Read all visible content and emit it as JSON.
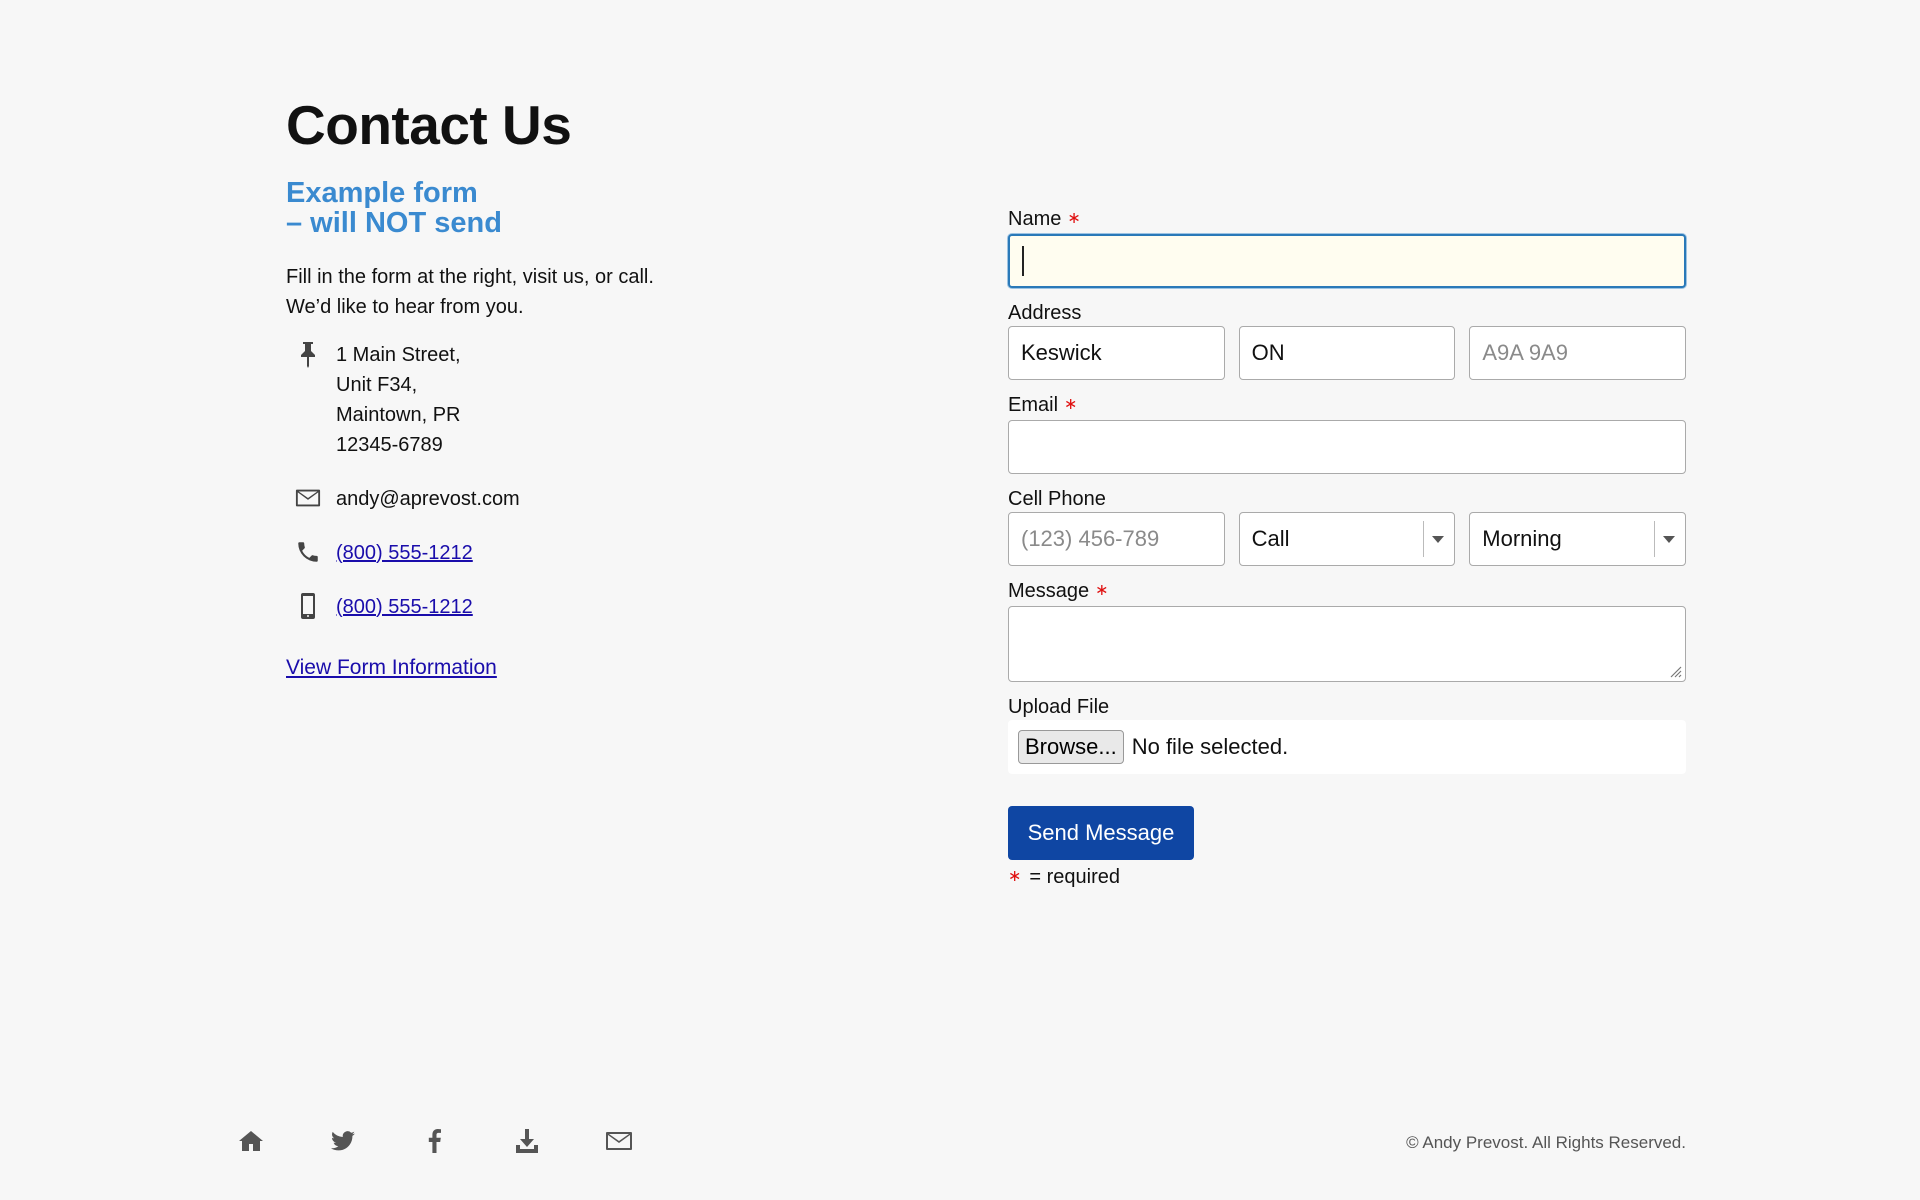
{
  "left": {
    "title": "Contact Us",
    "subtitle_line1": "Example form",
    "subtitle_line2_prefix": "– will ",
    "subtitle_line2_strong": "NOT",
    "subtitle_line2_suffix": " send",
    "intro_line1": "Fill in the form at the right, visit us, or call.",
    "intro_line2": "We’d like to hear from you.",
    "address_lines": [
      "1 Main Street,",
      "Unit F34,",
      "Maintown, PR",
      "12345-6789"
    ],
    "email": "andy@aprevost.com",
    "phone": "(800) 555-1212",
    "mobile": "(800) 555-1212",
    "view_info_link": "View Form Information",
    "icons": {
      "address": "pushpin-icon",
      "email": "envelope-icon",
      "phone": "phone-icon",
      "mobile": "mobile-phone-icon"
    }
  },
  "form": {
    "name_label": "Name",
    "address_label": "Address",
    "address_city_value": "Keswick",
    "address_province_value": "ON",
    "address_postal_placeholder": "A9A 9A9",
    "email_label": "Email",
    "cell_label": "Cell Phone",
    "cell_placeholder": "(123) 456-789",
    "contact_method_selected": "Call",
    "contact_time_selected": "Morning",
    "message_label": "Message",
    "upload_label": "Upload File",
    "browse_label": "Browse...",
    "no_file_text": "No file selected.",
    "send_label": "Send Message",
    "required_marker": "∗",
    "required_note": "= required"
  },
  "footer": {
    "icons": [
      "home-icon",
      "twitter-icon",
      "facebook-icon",
      "download-icon",
      "envelope-icon"
    ],
    "copyright": "© Andy Prevost. All Rights Reserved."
  },
  "colors": {
    "background": "#f7f7f7",
    "accent_blue": "#3a8ad0",
    "button_blue": "#0f46a3",
    "required_red": "#e01010",
    "focus_field_bg": "#fffdf0"
  }
}
